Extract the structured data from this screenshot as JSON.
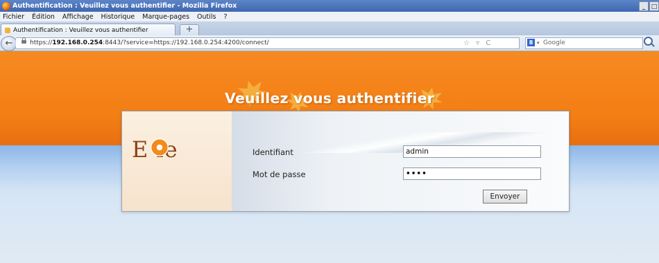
{
  "window": {
    "title": "Authentification : Veuillez vous authentifier - Mozilla Firefox",
    "controls": {
      "minimize": "_",
      "maximize": "□"
    }
  },
  "menubar": [
    "Fichier",
    "Édition",
    "Affichage",
    "Historique",
    "Marque-pages",
    "Outils",
    "?"
  ],
  "tabs": [
    {
      "label": "Authentification : Veuillez vous authentifier",
      "active": true
    }
  ],
  "new_tab_label": "+",
  "navigation": {
    "back_label": "←",
    "url_prefix": "https://",
    "url_host": "192.168.0.254",
    "url_rest": ":8443/?service=https://192.168.0.254:4200/connect/",
    "url_actions": "☆ ▿ C",
    "search_engine_letter": "8",
    "search_engine_caret": "▾",
    "search_placeholder": "Google"
  },
  "page": {
    "banner_title": "Veuillez vous authentifier",
    "logo_text": "E  le",
    "form": {
      "username_label": "Identifiant",
      "username_value": "admin",
      "password_label": "Mot de passe",
      "password_value": "••••",
      "submit_label": "Envoyer"
    }
  },
  "colors": {
    "banner": "#f37e14",
    "logo": "#8a4218",
    "leaf": "#f5b341"
  }
}
